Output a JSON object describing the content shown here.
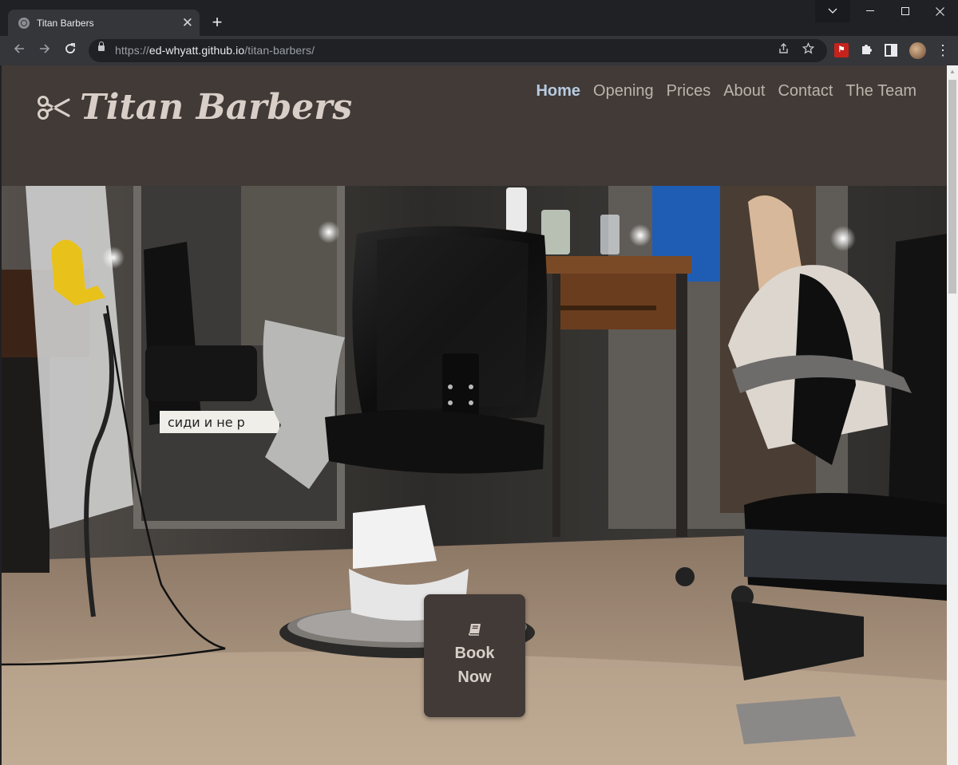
{
  "browser": {
    "tab_title": "Titan Barbers",
    "tab_close": "✕",
    "new_tab": "+",
    "url_scheme": "https://",
    "url_host": "ed-whyatt.github.io",
    "url_path": "/titan-barbers/",
    "icons": [
      "back-arrow-icon",
      "forward-arrow-icon",
      "reload-icon",
      "lock-icon",
      "share-icon",
      "star-icon",
      "pdf-extension-icon",
      "puzzle-icon",
      "side-panel-icon",
      "profile-avatar",
      "menu-dots-icon"
    ]
  },
  "site": {
    "logo_text": "Titan Barbers",
    "logo_icon": "scissors-icon",
    "nav": {
      "home": "Home",
      "opening": "Opening",
      "prices": "Prices",
      "about": "About",
      "contact": "Contact",
      "team": "The Team"
    },
    "hero_sign_text": "сиди и не р",
    "book": {
      "line1": "Book",
      "line2": "Now",
      "icon": "book-icon"
    }
  },
  "colors": {
    "header_bg": "#413a37",
    "logo_text": "#d9cfc8",
    "nav_text": "#bdb3ab",
    "nav_active": "#b7cbe0"
  }
}
